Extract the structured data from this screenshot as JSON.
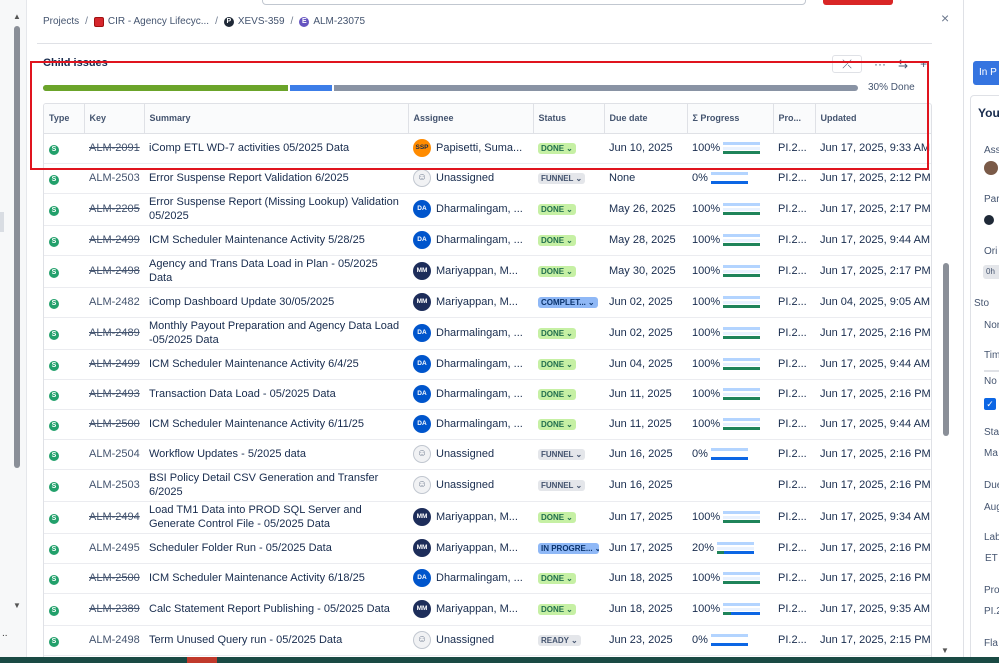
{
  "breadcrumb": {
    "projects": "Projects",
    "project": "CIR - Agency Lifecyc...",
    "parent": "XEVS-359",
    "epic": "ALM-23075",
    "project_icon_letter": "",
    "parent_icon_letter": "P",
    "epic_icon_letter": "E"
  },
  "child_issues": {
    "title": "Child issues",
    "progress_label": "30% Done",
    "progress": {
      "done_fraction": 0.3,
      "in_progress_fraction": 0.057
    },
    "columns": [
      "Type",
      "Key",
      "Summary",
      "Assignee",
      "Status",
      "Due date",
      "Σ Progress",
      "Pro...",
      "Updated"
    ],
    "rows": [
      {
        "type": "S",
        "key": "ALM-2091⁠",
        "summary": "iComp ETL WD-7 activities 05/2025 Data",
        "avatar": "SSP",
        "avatar_kind": "ssp",
        "assignee": "Papisetti, Suma...",
        "status": "DONE",
        "status_kind": "done",
        "due": "Jun 10, 2025",
        "progress": "100%",
        "progress_kind": "full",
        "pro": "PI.2...",
        "updated": "Jun 17, 2025, 9:33 AM",
        "struck": true
      },
      {
        "type": "S",
        "key": "ALM-2503",
        "summary": "Error Suspense Report Validation 6/2025",
        "avatar": "☺",
        "avatar_kind": "un",
        "assignee": "Unassigned",
        "status": "FUNNEL",
        "status_kind": "funnel",
        "due": "None",
        "progress": "0%",
        "progress_kind": "zero",
        "pro": "PI.2...",
        "updated": "Jun 17, 2025, 2:12 PM",
        "struck": false
      },
      {
        "type": "S",
        "key": "ALM-2205",
        "summary": "Error Suspense Report (Missing Lookup) Validation 05/2025",
        "avatar": "DA",
        "avatar_kind": "da",
        "assignee": "Dharmalingam, ...",
        "status": "DONE",
        "status_kind": "done",
        "due": "May 26, 2025",
        "progress": "100%",
        "progress_kind": "full",
        "pro": "PI.2...",
        "updated": "Jun 17, 2025, 2:17 PM",
        "struck": true
      },
      {
        "type": "S",
        "key": "ALM-2499",
        "summary": "ICM Scheduler Maintenance Activity 5/28/25",
        "avatar": "DA",
        "avatar_kind": "da",
        "assignee": "Dharmalingam, ...",
        "status": "DONE",
        "status_kind": "done",
        "due": "May 28, 2025",
        "progress": "100%",
        "progress_kind": "full",
        "pro": "PI.2...",
        "updated": "Jun 17, 2025, 9:44 AM",
        "struck": true
      },
      {
        "type": "S",
        "key": "ALM-2498",
        "summary": "Agency and Trans Data Load in Plan - 05/2025 Data",
        "avatar": "MM",
        "avatar_kind": "mm",
        "assignee": "Mariyappan, M...",
        "status": "DONE",
        "status_kind": "done",
        "due": "May 30, 2025",
        "progress": "100%",
        "progress_kind": "full",
        "pro": "PI.2...",
        "updated": "Jun 17, 2025, 2:17 PM",
        "struck": true
      },
      {
        "type": "S",
        "key": "ALM-2482",
        "summary": "iComp Dashboard Update 30/05/2025",
        "avatar": "MM",
        "avatar_kind": "mm",
        "assignee": "Mariyappan, M...",
        "status": "COMPLET...",
        "status_kind": "complete",
        "due": "Jun 02, 2025",
        "progress": "100%",
        "progress_kind": "full",
        "pro": "PI.2...",
        "updated": "Jun 04, 2025, 9:05 AM",
        "struck": false
      },
      {
        "type": "S",
        "key": "ALM-2489",
        "summary": "Monthly Payout Preparation and Agency Data Load -05/2025 Data",
        "avatar": "DA",
        "avatar_kind": "da",
        "assignee": "Dharmalingam, ...",
        "status": "DONE",
        "status_kind": "done",
        "due": "Jun 02, 2025",
        "progress": "100%",
        "progress_kind": "full",
        "pro": "PI.2...",
        "updated": "Jun 17, 2025, 2:16 PM",
        "struck": true
      },
      {
        "type": "S",
        "key": "ALM-2499",
        "summary": "ICM Scheduler Maintenance Activity 6/4/25",
        "avatar": "DA",
        "avatar_kind": "da",
        "assignee": "Dharmalingam, ...",
        "status": "DONE",
        "status_kind": "done",
        "due": "Jun 04, 2025",
        "progress": "100%",
        "progress_kind": "full",
        "pro": "PI.2...",
        "updated": "Jun 17, 2025, 9:44 AM",
        "struck": true
      },
      {
        "type": "S",
        "key": "ALM-2493",
        "summary": "Transaction Data Load - 05/2025 Data",
        "avatar": "DA",
        "avatar_kind": "da",
        "assignee": "Dharmalingam, ...",
        "status": "DONE",
        "status_kind": "done",
        "due": "Jun 11, 2025",
        "progress": "100%",
        "progress_kind": "full",
        "pro": "PI.2...",
        "updated": "Jun 17, 2025, 2:16 PM",
        "struck": true
      },
      {
        "type": "S",
        "key": "ALM-2500",
        "summary": "ICM Scheduler Maintenance Activity 6/11/25",
        "avatar": "DA",
        "avatar_kind": "da",
        "assignee": "Dharmalingam, ...",
        "status": "DONE",
        "status_kind": "done",
        "due": "Jun 11, 2025",
        "progress": "100%",
        "progress_kind": "full",
        "pro": "PI.2...",
        "updated": "Jun 17, 2025, 9:44 AM",
        "struck": true
      },
      {
        "type": "S",
        "key": "ALM-2504",
        "summary": "Workflow Updates - 5/2025 data",
        "avatar": "☺",
        "avatar_kind": "un",
        "assignee": "Unassigned",
        "status": "FUNNEL",
        "status_kind": "funnel",
        "due": "Jun 16, 2025",
        "progress": "0%",
        "progress_kind": "zero",
        "pro": "PI.2...",
        "updated": "Jun 17, 2025, 2:16 PM",
        "struck": false
      },
      {
        "type": "S",
        "key": "ALM-2503",
        "summary": "BSI Policy Detail CSV Generation and Transfer 6/2025",
        "avatar": "☺",
        "avatar_kind": "un",
        "assignee": "Unassigned",
        "status": "FUNNEL",
        "status_kind": "funnel",
        "due": "Jun 16, 2025",
        "progress": "",
        "progress_kind": "none",
        "pro": "PI.2...",
        "updated": "Jun 17, 2025, 2:16 PM",
        "struck": false
      },
      {
        "type": "S",
        "key": "ALM-2494",
        "summary": "Load TM1 Data into PROD SQL Server and Generate Control File - 05/2025 Data",
        "avatar": "MM",
        "avatar_kind": "mm",
        "assignee": "Mariyappan, M...",
        "status": "DONE",
        "status_kind": "done",
        "due": "Jun 17, 2025",
        "progress": "100%",
        "progress_kind": "full",
        "pro": "PI.2...",
        "updated": "Jun 17, 2025, 9:34 AM",
        "struck": true
      },
      {
        "type": "S",
        "key": "ALM-2495",
        "summary": "Scheduler Folder Run - 05/2025 Data",
        "avatar": "MM",
        "avatar_kind": "mm",
        "assignee": "Mariyappan, M...",
        "status": "IN PROGRE...",
        "status_kind": "inprog",
        "due": "Jun 17, 2025",
        "progress": "20%",
        "progress_kind": "partial",
        "progress_fill": 0.2,
        "pro": "PI.2...",
        "updated": "Jun 17, 2025, 2:16 PM",
        "struck": false
      },
      {
        "type": "S",
        "key": "ALM-2500",
        "summary": "ICM Scheduler Maintenance Activity 6/18/25",
        "avatar": "DA",
        "avatar_kind": "da",
        "assignee": "Dharmalingam, ...",
        "status": "DONE",
        "status_kind": "done",
        "due": "Jun 18, 2025",
        "progress": "100%",
        "progress_kind": "full",
        "pro": "PI.2...",
        "updated": "Jun 17, 2025, 2:16 PM",
        "struck": true
      },
      {
        "type": "S",
        "key": "ALM-2389",
        "summary": "Calc Statement Report Publishing - 05/2025 Data",
        "avatar": "MM",
        "avatar_kind": "mm",
        "assignee": "Mariyappan, M...",
        "status": "DONE",
        "status_kind": "done",
        "due": "Jun 18, 2025",
        "progress": "100%",
        "progress_kind": "partial",
        "progress_fill": 0.2,
        "pro": "PI.2...",
        "updated": "Jun 17, 2025, 9:35 AM",
        "struck": true
      },
      {
        "type": "S",
        "key": "ALM-2498",
        "summary": "Term Unused Query run - 05/2025 Data",
        "avatar": "☺",
        "avatar_kind": "un",
        "assignee": "Unassigned",
        "status": "READY",
        "status_kind": "ready",
        "due": "Jun 23, 2025",
        "progress": "0%",
        "progress_kind": "zero",
        "pro": "PI.2...",
        "updated": "Jun 17, 2025, 2:15 PM",
        "struck": false
      }
    ]
  },
  "right_panel": {
    "status_button": "In P",
    "title": "You",
    "labels": [
      "Ass",
      "Par",
      "Ori",
      "Sto",
      "Nor",
      "Tim",
      "No",
      "Sta",
      "Ma",
      "Due",
      "Aug",
      "Lab",
      "ET",
      "Pro",
      "PI.2",
      "Fla"
    ],
    "chip": "0h"
  },
  "icons": [
    "cir-project-icon",
    "parent-issue-icon",
    "epic-icon",
    "story-type-icon",
    "collapse-icon",
    "more-icon",
    "link-icon",
    "add-icon",
    "chevron-down-icon",
    "close-icon"
  ],
  "colors": {
    "accent": "#3574e0",
    "done": "#6ba42a",
    "highlight": "#e0141e"
  }
}
